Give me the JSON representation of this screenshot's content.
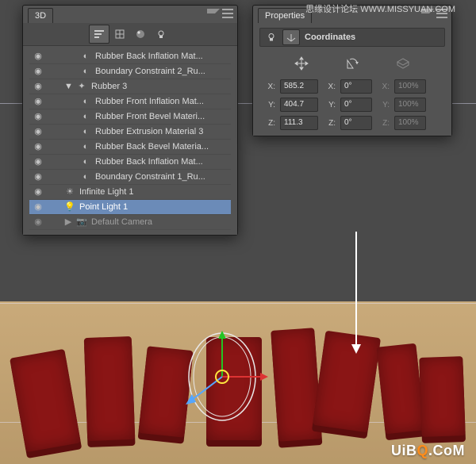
{
  "panels": {
    "threeD": {
      "title": "3D"
    },
    "properties": {
      "title": "Properties",
      "section": "Coordinates"
    }
  },
  "tree": {
    "items": [
      {
        "eye": true,
        "indent": 3,
        "icon": "sphere",
        "label": "Rubber Back Inflation Mat..."
      },
      {
        "eye": true,
        "indent": 3,
        "icon": "sphere",
        "label": "Boundary Constraint 2_Ru..."
      },
      {
        "eye": true,
        "indent": 1,
        "icon": "mesh",
        "label": "Rubber 3",
        "twisty": "▼"
      },
      {
        "eye": true,
        "indent": 3,
        "icon": "sphere",
        "label": "Rubber Front Inflation Mat..."
      },
      {
        "eye": true,
        "indent": 3,
        "icon": "sphere",
        "label": "Rubber Front Bevel Materi..."
      },
      {
        "eye": true,
        "indent": 3,
        "icon": "sphere",
        "label": "Rubber Extrusion Material 3"
      },
      {
        "eye": true,
        "indent": 3,
        "icon": "sphere",
        "label": "Rubber Back Bevel Materia..."
      },
      {
        "eye": true,
        "indent": 3,
        "icon": "sphere",
        "label": "Rubber Back Inflation Mat..."
      },
      {
        "eye": true,
        "indent": 3,
        "icon": "sphere",
        "label": "Boundary Constraint 1_Ru..."
      },
      {
        "eye": true,
        "indent": 1,
        "icon": "sun",
        "label": "Infinite Light 1"
      },
      {
        "eye": true,
        "indent": 1,
        "icon": "bulb",
        "label": "Point Light 1",
        "selected": true
      },
      {
        "eye": true,
        "indent": 1,
        "icon": "camera",
        "label": "Default Camera",
        "twisty": "▶",
        "dim": true
      }
    ]
  },
  "coordinates": {
    "row1": {
      "kx": "X:",
      "vx": "585.2",
      "kxr": "X:",
      "vxr": "0°",
      "kxs": "X:",
      "vxs": "100%"
    },
    "row2": {
      "ky": "Y:",
      "vy": "404.7",
      "kyr": "Y:",
      "vyr": "0°",
      "kys": "Y:",
      "vys": "100%"
    },
    "row3": {
      "kz": "Z:",
      "vz": "111.3",
      "kzr": "Z:",
      "vzr": "0°",
      "kzs": "Z:",
      "vzs": "100%"
    }
  },
  "watermarks": {
    "top": "思缘设计论坛    WWW.MISSYUAN.COM",
    "bottom_a": "UiB",
    "bottom_b": "Q",
    "bottom_c": ".CoM"
  }
}
